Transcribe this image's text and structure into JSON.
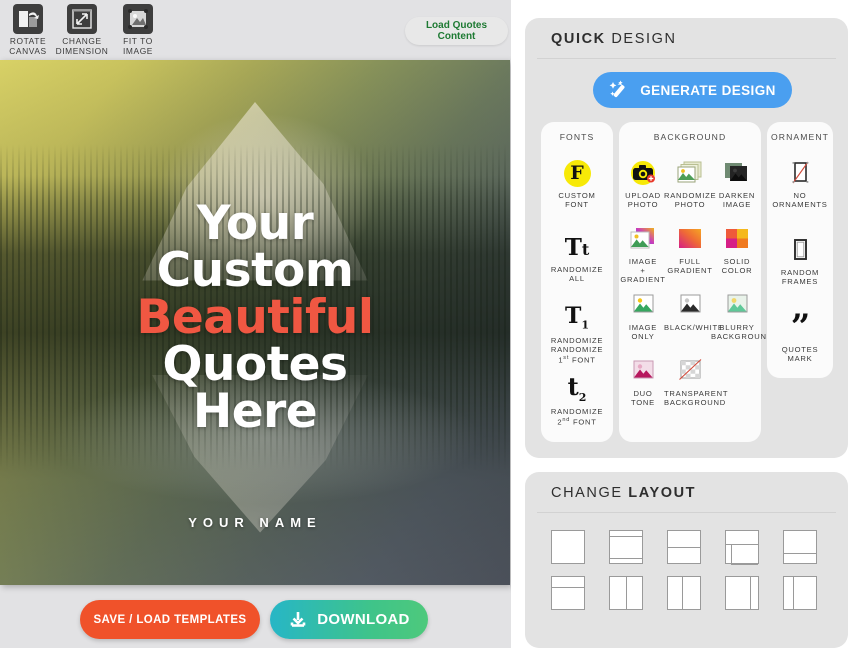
{
  "toolbar": {
    "tools": [
      {
        "label": "ROTATE\nCANVAS",
        "label_line1": "ROTATE",
        "label_line2": "CANVAS",
        "icon": "rotate-canvas-icon"
      },
      {
        "label_line1": "CHANGE",
        "label_line2": "DIMENSION",
        "icon": "change-dimension-icon"
      },
      {
        "label_line1": "FIT TO",
        "label_line2": "IMAGE",
        "icon": "fit-to-image-icon"
      }
    ],
    "load_quotes_line1": "Load Quotes",
    "load_quotes_line2": "Content"
  },
  "canvas": {
    "quote_lines": [
      {
        "text": "Your",
        "color": "white"
      },
      {
        "text": "Custom",
        "color": "white"
      },
      {
        "text": "Beautiful",
        "color": "accent"
      },
      {
        "text": "Quotes",
        "color": "white"
      },
      {
        "text": "Here",
        "color": "white"
      }
    ],
    "author": "YOUR NAME",
    "accent_color": "#f05742"
  },
  "actions": {
    "save_label": "SAVE / LOAD TEMPLATES",
    "download_label": "DOWNLOAD",
    "save_color": "#f0522a",
    "download_color": "#3fc489"
  },
  "quick_design": {
    "title_bold": "QUICK",
    "title_light": " DESIGN",
    "generate_label": "GENERATE DESIGN",
    "generate_color": "#4a9ff0",
    "fonts": {
      "title": "FONTS",
      "items": [
        {
          "glyph": "F",
          "line1": "CUSTOM",
          "line2": "FONT",
          "icon": "custom-font-icon"
        },
        {
          "glyph": "Tt",
          "line1": "RANDOMIZE",
          "line2": "ALL",
          "icon": "randomize-all-font-icon"
        },
        {
          "glyph": "T1",
          "line1": "RANDOMIZE",
          "line2": "1st FONT",
          "icon": "randomize-first-font-icon"
        },
        {
          "glyph": "t2",
          "line1": "RANDOMIZE",
          "line2": "2nd FONT",
          "icon": "randomize-second-font-icon"
        }
      ]
    },
    "background": {
      "title": "BACKGROUND",
      "items": [
        {
          "line1": "UPLOAD",
          "line2": "PHOTO",
          "icon": "upload-photo-icon"
        },
        {
          "line1": "RANDOMIZE",
          "line2": "PHOTO",
          "icon": "randomize-photo-icon"
        },
        {
          "line1": "DARKEN",
          "line2": "IMAGE",
          "icon": "darken-image-icon"
        },
        {
          "line1": "IMAGE",
          "line2": "+",
          "line3": "GRADIENT",
          "icon": "image-plus-gradient-icon"
        },
        {
          "line1": "FULL",
          "line2": "GRADIENT",
          "icon": "full-gradient-icon"
        },
        {
          "line1": "SOLID",
          "line2": "COLOR",
          "icon": "solid-color-icon"
        },
        {
          "line1": "IMAGE",
          "line2": "ONLY",
          "icon": "image-only-icon"
        },
        {
          "line1": "BLACK/WHITE",
          "line2": "",
          "icon": "black-white-icon"
        },
        {
          "line1": "BLURRY",
          "line2": "BACKGROUND",
          "icon": "blurry-background-icon"
        },
        {
          "line1": "DUO",
          "line2": "TONE",
          "icon": "duo-tone-icon"
        },
        {
          "line1": "TRANSPARENT",
          "line2": "BACKGROUND",
          "icon": "transparent-background-icon"
        }
      ]
    },
    "ornament": {
      "title": "ORNAMENT",
      "items": [
        {
          "line1": "NO",
          "line2": "ORNAMENTS",
          "icon": "no-ornaments-icon"
        },
        {
          "line1": "RANDOM",
          "line2": "FRAMES",
          "icon": "random-frames-icon"
        },
        {
          "line1": "QUOTES",
          "line2": "MARK",
          "icon": "quotes-mark-icon"
        }
      ]
    }
  },
  "change_layout": {
    "title_light": "CHANGE ",
    "title_bold": "LAYOUT",
    "thumbs": [
      {
        "name": "layout-full"
      },
      {
        "name": "layout-top-bottom-bands"
      },
      {
        "name": "layout-split-middle"
      },
      {
        "name": "layout-offset-lower"
      },
      {
        "name": "layout-split-low"
      },
      {
        "name": "layout-top-band"
      },
      {
        "name": "layout-vertical-half"
      },
      {
        "name": "layout-vertical-center"
      },
      {
        "name": "layout-vertical-right"
      },
      {
        "name": "layout-vertical-left"
      }
    ]
  }
}
